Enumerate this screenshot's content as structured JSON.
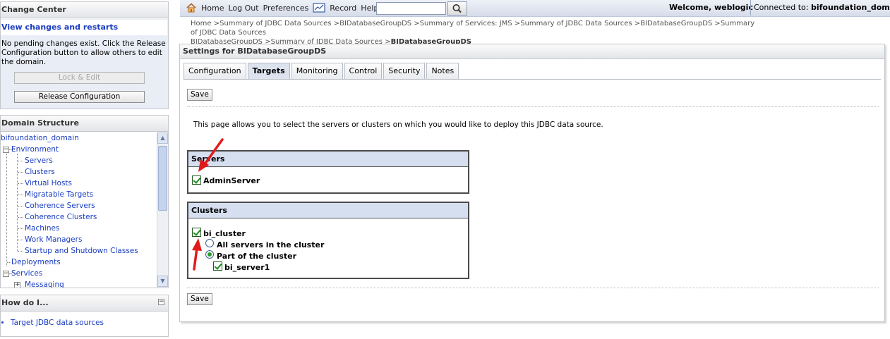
{
  "change_center": {
    "title": "Change Center",
    "view_changes": "View changes and restarts",
    "message": "No pending changes exist. Click the Release Configuration button to allow others to edit the domain.",
    "lock_edit": "Lock & Edit",
    "release_configuration": "Release Configuration"
  },
  "domain_structure": {
    "title": "Domain Structure",
    "root": "bifoundation_domain",
    "environment": "Environment",
    "items": [
      "Servers",
      "Clusters",
      "Virtual Hosts",
      "Migratable Targets",
      "Coherence Servers",
      "Coherence Clusters",
      "Machines",
      "Work Managers",
      "Startup and Shutdown Classes"
    ],
    "deployments": "Deployments",
    "services": "Services",
    "messaging": "Messaging"
  },
  "how_do_i": {
    "title": "How do I...",
    "links": [
      "Target JDBC data sources"
    ]
  },
  "topbar": {
    "home": "Home",
    "logout": "Log Out",
    "preferences": "Preferences",
    "record": "Record",
    "help": "Help",
    "search_value": "",
    "welcome": "Welcome, weblogic",
    "connected_label": "Connected to:",
    "connected_domain": "bifoundation_domain"
  },
  "breadcrumb": {
    "items": [
      "Home",
      "Summary of JDBC Data Sources",
      "BIDatabaseGroupDS",
      "Summary of Services: JMS",
      "Summary of JDBC Data Sources",
      "BIDatabaseGroupDS",
      "Summary of JDBC Data Sources",
      "BIDatabaseGroupDS",
      "Summary of JDBC Data Sources"
    ],
    "current": "BIDatabaseGroupDS"
  },
  "settings": {
    "title": "Settings for BIDatabaseGroupDS",
    "tabs": [
      "Configuration",
      "Targets",
      "Monitoring",
      "Control",
      "Security",
      "Notes"
    ],
    "active_tab": "Targets",
    "save": "Save",
    "intro": "This page allows you to select the servers or clusters on which you would like to deploy this JDBC data source.",
    "servers_header": "Servers",
    "admin_server": "AdminServer",
    "clusters_header": "Clusters",
    "cluster_name": "bi_cluster",
    "all_servers": "All servers in the cluster",
    "part_of_cluster": "Part of the cluster",
    "cluster_server": "bi_server1"
  },
  "colors": {
    "link": "#1a3dc1",
    "box_header": "#d5dff0",
    "arrow": "#e11b1b"
  }
}
